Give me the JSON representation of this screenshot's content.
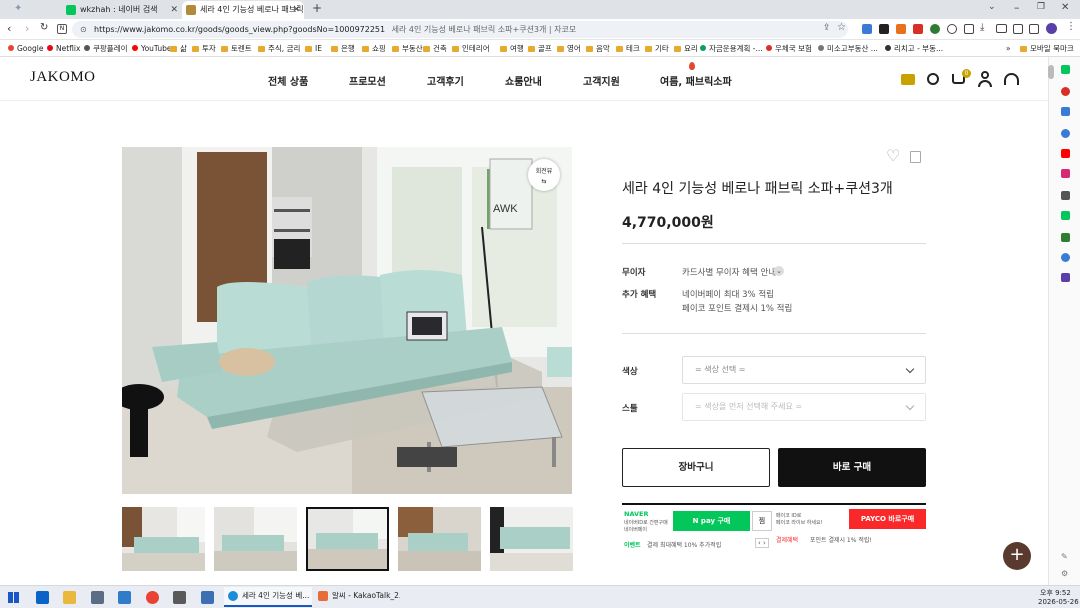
{
  "browser": {
    "tabs": [
      {
        "label": "wkzhah : 네이버 검색",
        "favicon_color": "#03c75a"
      },
      {
        "label": "세라 4인 기능성 베로나 패브릭",
        "favicon_color": "#b28a3a"
      }
    ],
    "new_tab": "+",
    "url_main": "https://www.jakomo.co.kr/goods/goods_view.php?goodsNo=1000972251",
    "url_title": "세라 4인 기능성 베로나 패브릭 소파+쿠션3개 | 자코모",
    "bookmarks": [
      {
        "label": "Google",
        "type": "dot",
        "color": "#ea4335"
      },
      {
        "label": "Netflix",
        "type": "dot",
        "color": "#e50914"
      },
      {
        "label": "쿠팡플레이",
        "type": "dot",
        "color": "#555"
      },
      {
        "label": "YouTube",
        "type": "dot",
        "color": "#ff0000"
      },
      {
        "label": "삶",
        "type": "folder"
      },
      {
        "label": "투자",
        "type": "folder"
      },
      {
        "label": "토렌트",
        "type": "folder"
      },
      {
        "label": "주식, 금리",
        "type": "folder"
      },
      {
        "label": "IE",
        "type": "folder"
      },
      {
        "label": "은행",
        "type": "folder"
      },
      {
        "label": "쇼핑",
        "type": "folder"
      },
      {
        "label": "부동산",
        "type": "folder"
      },
      {
        "label": "건축",
        "type": "folder"
      },
      {
        "label": "인테리어",
        "type": "folder"
      },
      {
        "label": "여행",
        "type": "folder"
      },
      {
        "label": "골프",
        "type": "folder"
      },
      {
        "label": "영어",
        "type": "folder"
      },
      {
        "label": "음악",
        "type": "folder"
      },
      {
        "label": "테크",
        "type": "folder"
      },
      {
        "label": "기타",
        "type": "folder"
      },
      {
        "label": "요리",
        "type": "folder"
      },
      {
        "label": "자금운용계획 -...",
        "type": "dot",
        "color": "#0f9d58"
      },
      {
        "label": "우체국 보험",
        "type": "dot",
        "color": "#d93025"
      },
      {
        "label": "미소고부동산 ...",
        "type": "dot",
        "color": "#777"
      },
      {
        "label": "리치고 - 부동...",
        "type": "dot",
        "color": "#333"
      }
    ],
    "bookmarks_more": "»",
    "bookmarks_mobile": "모바일 북마크"
  },
  "site": {
    "logo": "JAKOMO",
    "nav": [
      "전체 상품",
      "프로모션",
      "고객후기",
      "쇼룸안내",
      "고객지원",
      "여름, 패브릭소파"
    ],
    "cart_count": "0",
    "rotate_badge": "회전뷰"
  },
  "product": {
    "title": "세라 4인 기능성 베로나 패브릭 소파+쿠션3개",
    "price": "4,770,000원",
    "interest_label": "무이자",
    "interest_value": "카드사별 무이자 혜택 안내",
    "benefit_label": "추가 혜택",
    "benefit_lines": [
      "네이버페이 최대 3% 적립",
      "페이코 포인트 결제시 1% 적립"
    ],
    "color_label": "색상",
    "color_placeholder": "= 색상 선택 =",
    "stool_label": "스툴",
    "stool_placeholder": "= 색상을 먼저 선택해 주세요 =",
    "cart_button": "장바구니",
    "buy_button": "바로 구매",
    "naver_brand": "NAVER",
    "naver_lines": [
      "네이버ID로 간편구매",
      "네이버페이"
    ],
    "npay_button": "N pay 구매",
    "jjim": "찜",
    "payco_lines": [
      "페이코 ID로",
      "페이코 라이브 하세요!"
    ],
    "payco_button": "PAYCO 바로구매",
    "event_tag": "이벤트",
    "event_text": "결제 최대혜택 10% 추가적립",
    "payco_note_tag": "결제혜택",
    "payco_note_text": "포인트 결제시 1% 적립!",
    "pager": "‹ ›"
  },
  "taskbar": {
    "items": [
      {
        "label": "세라 4인 기능성 베..."
      },
      {
        "label": "알씨 - KakaoTalk_2..."
      }
    ],
    "time": "오후 9:52",
    "date": "2026-05-26"
  },
  "colors": {
    "accent_black": "#111111",
    "npay_green": "#03c75a",
    "payco_red": "#fa2828",
    "mint_sofa": "#b7d9d2"
  }
}
